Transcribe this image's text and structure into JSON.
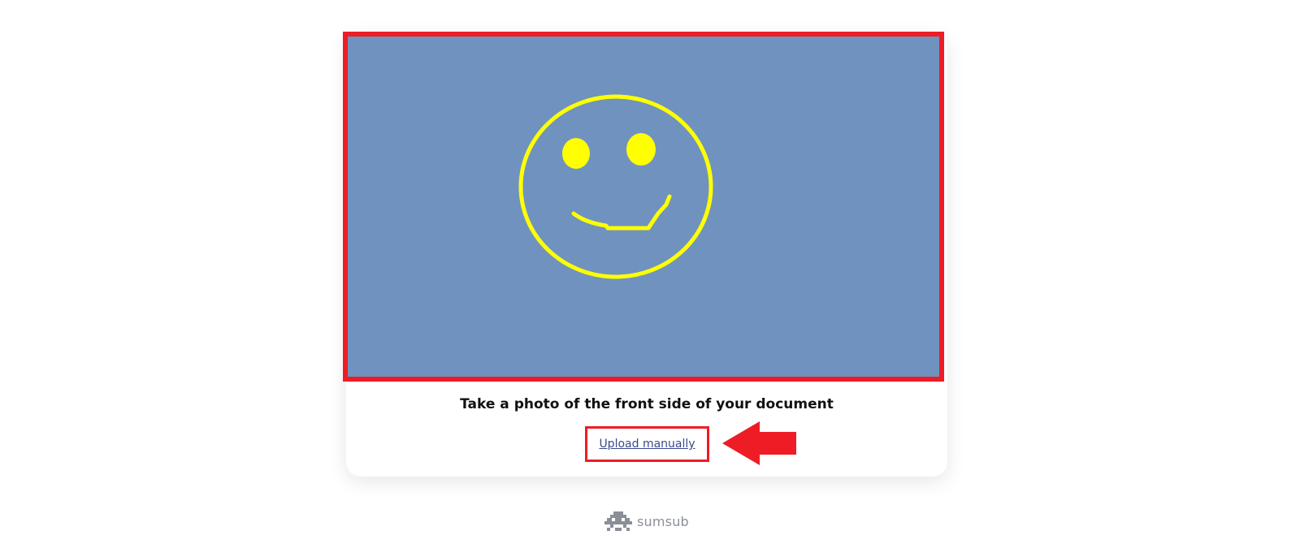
{
  "instruction": "Take a photo of the front side of your document",
  "upload_label": "Upload manually",
  "brand_name": "sumsub",
  "colors": {
    "preview_background": "#6f93be",
    "highlight": "#ee1c25",
    "smiley": "#ffff00",
    "link": "#3a4a8c",
    "brand": "#8a8f98"
  }
}
